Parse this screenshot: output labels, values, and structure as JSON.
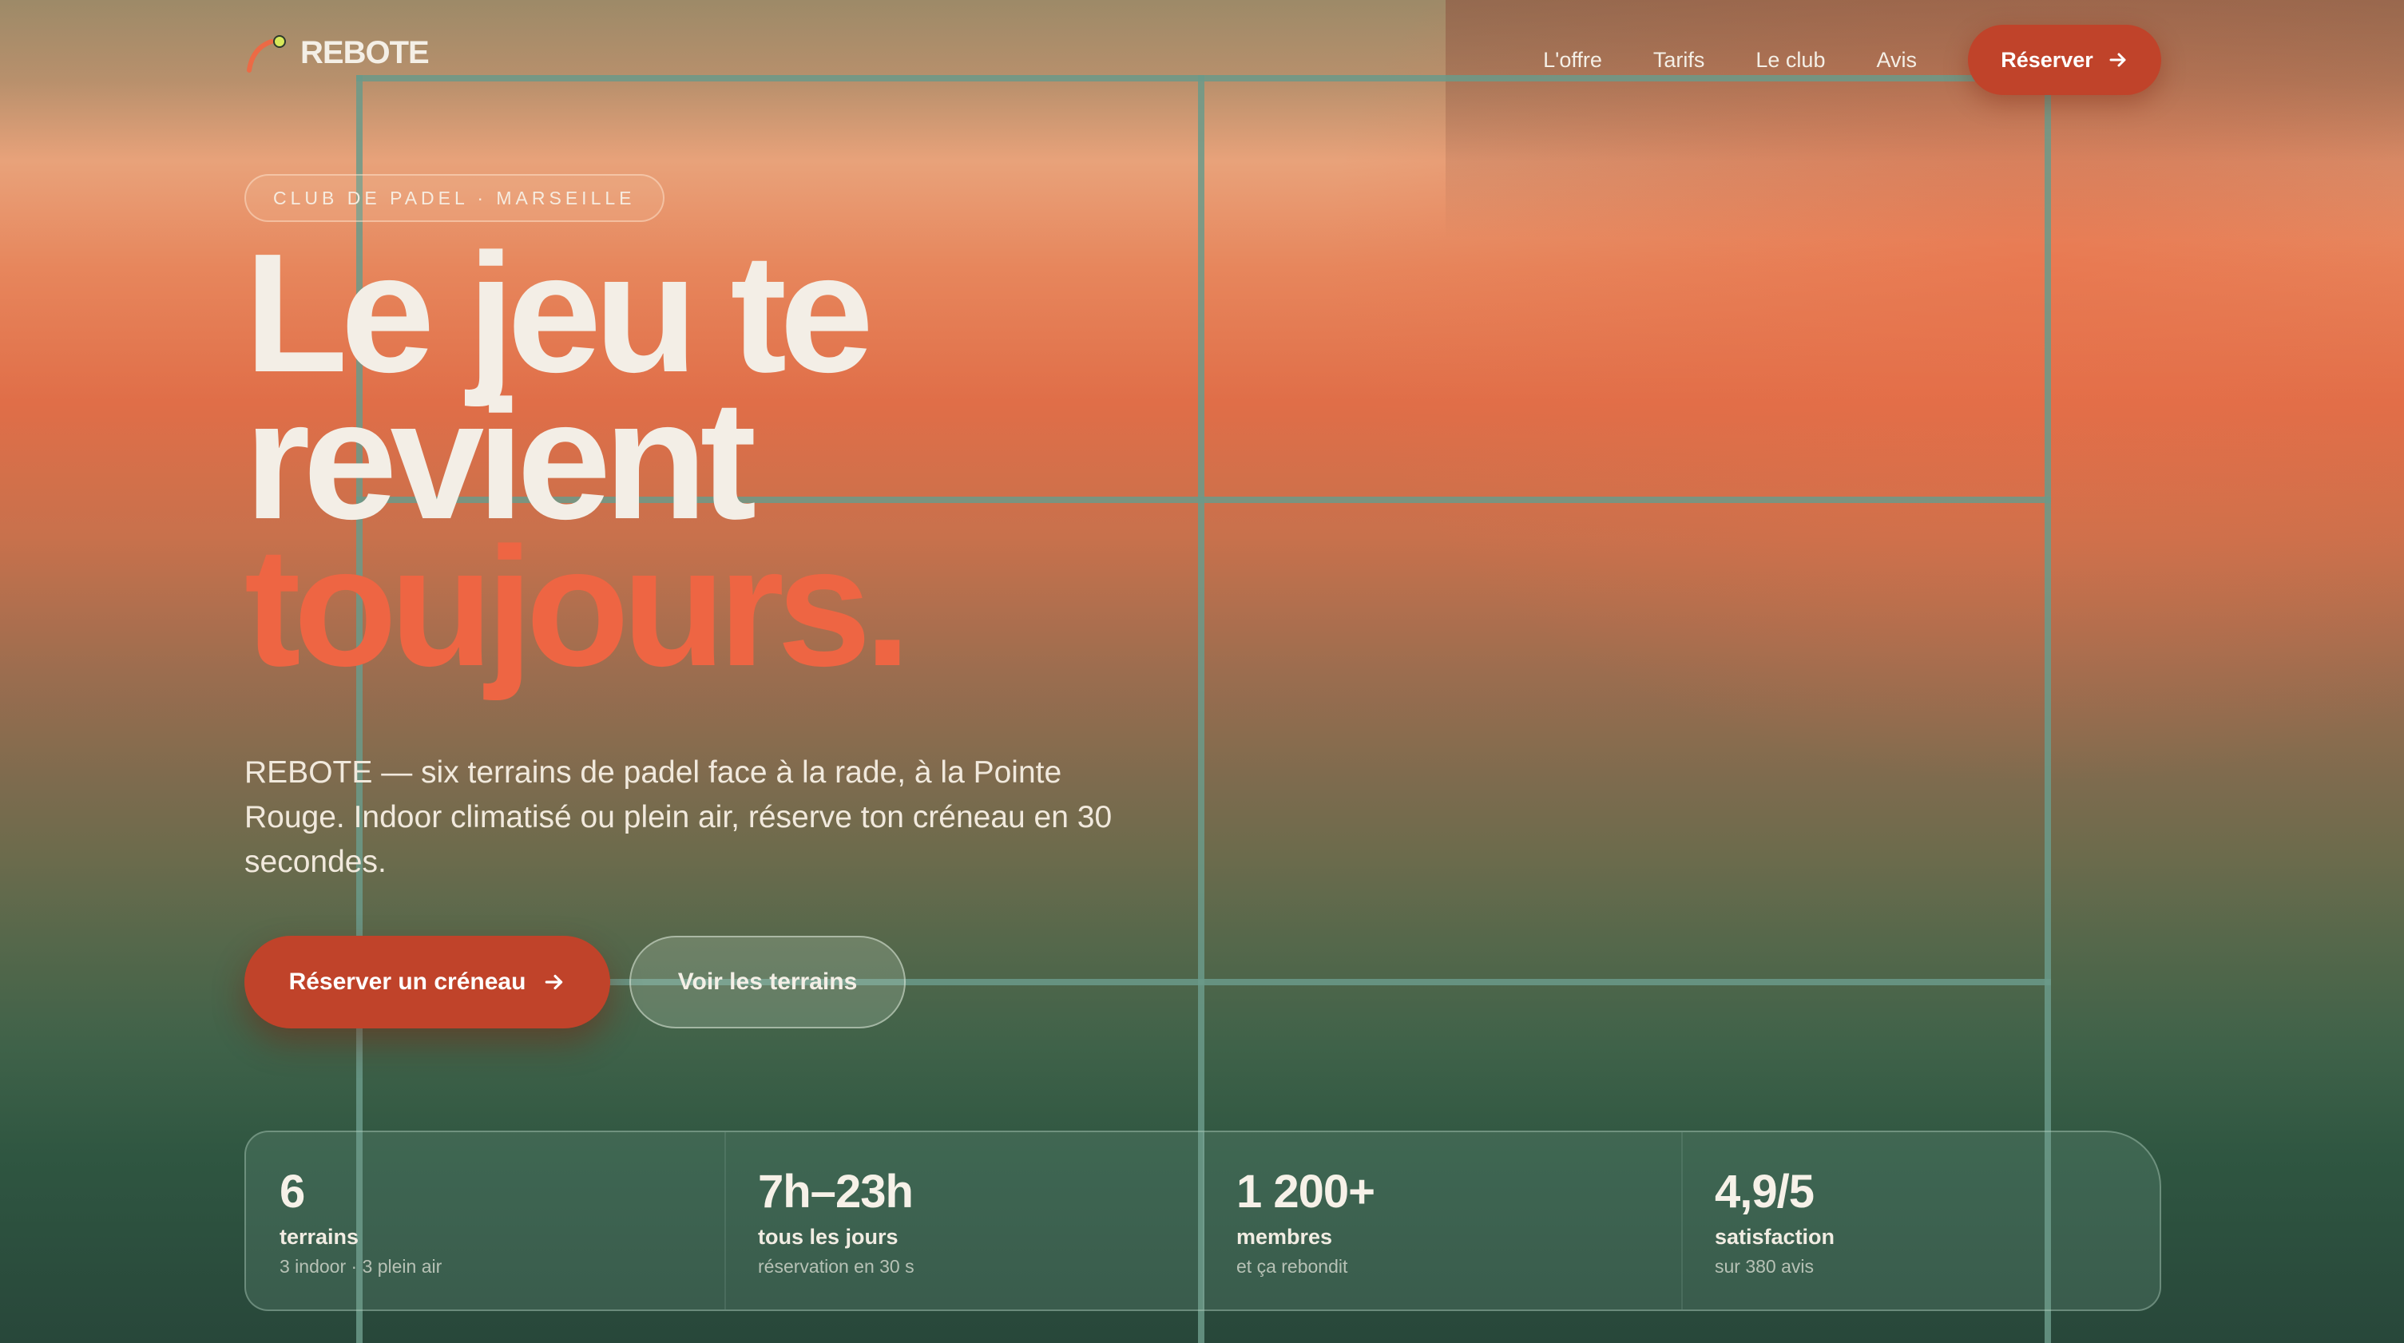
{
  "brand": {
    "name": "REBOTE"
  },
  "nav": {
    "links": [
      "L'offre",
      "Tarifs",
      "Le club",
      "Avis"
    ],
    "cta": "Réserver"
  },
  "hero": {
    "badge": "CLUB DE PADEL · MARSEILLE",
    "title_line1": "Le jeu te",
    "title_line2": "revient",
    "title_accent": "toujours.",
    "lede": "REBOTE — six terrains de padel face à la rade, à la Pointe Rouge. Indoor climatisé ou plein air, réserve ton créneau en 30 secondes.",
    "primary_cta": "Réserver un créneau",
    "secondary_cta": "Voir les terrains"
  },
  "stats": [
    {
      "value": "6",
      "label": "terrains",
      "sub": "3 indoor · 3 plein air"
    },
    {
      "value": "7h–23h",
      "label": "tous les jours",
      "sub": "réservation en 30 s"
    },
    {
      "value": "1 200+",
      "label": "membres",
      "sub": "et ça rebondit"
    },
    {
      "value": "4,9/5",
      "label": "satisfaction",
      "sub": "sur 380 avis"
    }
  ],
  "colors": {
    "accent": "#c0432a",
    "accent_text": "#ee6543",
    "court_line": "#6b9a8a"
  },
  "icons": {
    "logo": "padel-swoosh-logo",
    "arrow": "arrow-right-icon"
  }
}
